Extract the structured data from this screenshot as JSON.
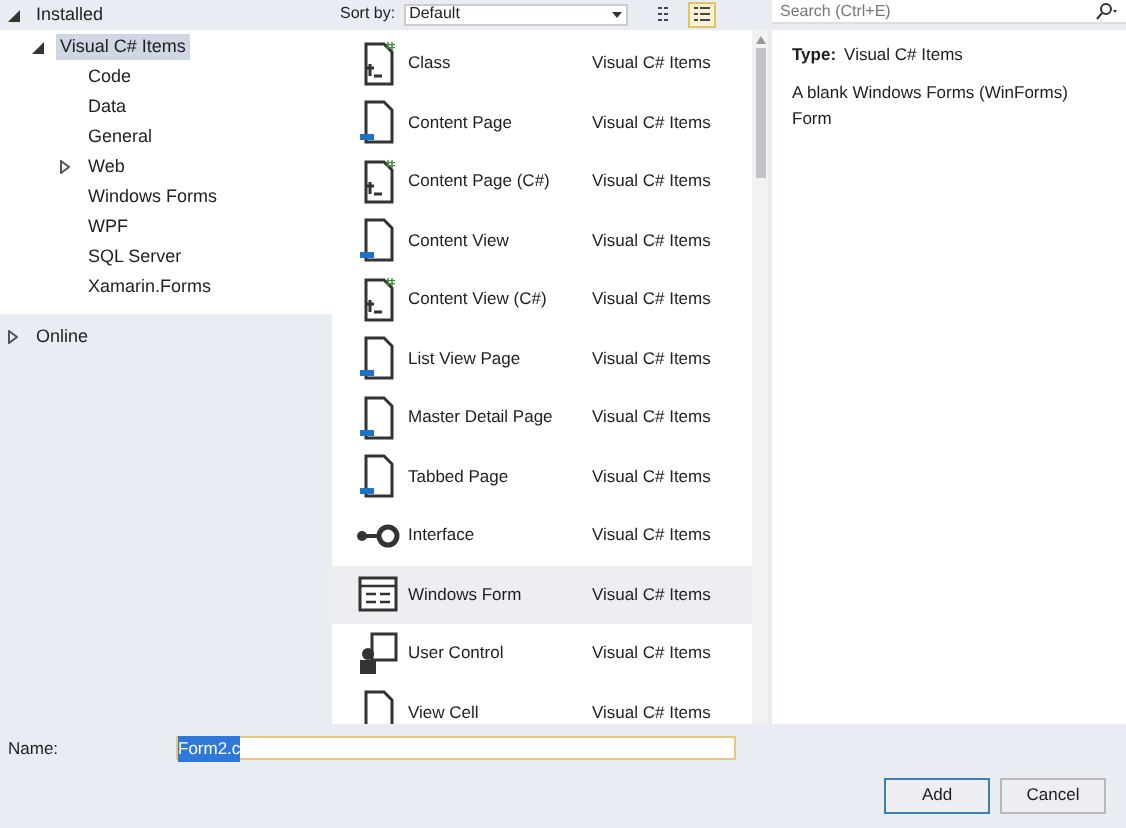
{
  "tree": [
    {
      "label": "Installed",
      "expanded": true,
      "selected": false,
      "children": [
        {
          "label": "Visual C# Items",
          "expanded": true,
          "selected": true,
          "children": [
            {
              "label": "Code",
              "selected": false
            },
            {
              "label": "Data",
              "selected": false
            },
            {
              "label": "General",
              "selected": false
            },
            {
              "label": "Web",
              "expanded": false,
              "selected": false
            },
            {
              "label": "Windows Forms",
              "selected": false
            },
            {
              "label": "WPF",
              "selected": false
            },
            {
              "label": "SQL Server",
              "selected": false
            },
            {
              "label": "Xamarin.Forms",
              "selected": false
            }
          ]
        }
      ]
    },
    {
      "label": "Online",
      "expanded": false,
      "selected": false
    }
  ],
  "sort": {
    "label": "Sort by:",
    "value": "Default"
  },
  "view_modes": [
    {
      "kind": "grid",
      "selected": false
    },
    {
      "kind": "list",
      "selected": true
    }
  ],
  "templates": [
    {
      "name": "Class",
      "category": "Visual C# Items",
      "kind": "code",
      "selected": false
    },
    {
      "name": "Content Page",
      "category": "Visual C# Items",
      "kind": "page",
      "selected": false
    },
    {
      "name": "Content Page (C#)",
      "category": "Visual C# Items",
      "kind": "code",
      "selected": false
    },
    {
      "name": "Content View",
      "category": "Visual C# Items",
      "kind": "page",
      "selected": false
    },
    {
      "name": "Content View (C#)",
      "category": "Visual C# Items",
      "kind": "code",
      "selected": false
    },
    {
      "name": "List View Page",
      "category": "Visual C# Items",
      "kind": "page",
      "selected": false
    },
    {
      "name": "Master Detail Page",
      "category": "Visual C# Items",
      "kind": "page",
      "selected": false
    },
    {
      "name": "Tabbed Page",
      "category": "Visual C# Items",
      "kind": "page",
      "selected": false
    },
    {
      "name": "Interface",
      "category": "Visual C# Items",
      "kind": "interface",
      "selected": false
    },
    {
      "name": "Windows Form",
      "category": "Visual C# Items",
      "kind": "form",
      "selected": true
    },
    {
      "name": "User Control",
      "category": "Visual C# Items",
      "kind": "control",
      "selected": false
    },
    {
      "name": "View Cell",
      "category": "Visual C# Items",
      "kind": "blank",
      "selected": false
    }
  ],
  "search": {
    "placeholder": "Search (Ctrl+E)"
  },
  "details": {
    "type_label": "Type:",
    "type_value": "Visual C# Items",
    "description": "A blank Windows Forms (WinForms) Form"
  },
  "name_field": {
    "label": "Name:",
    "value": "Form2.c"
  },
  "buttons": [
    {
      "label": "Add",
      "default": true
    },
    {
      "label": "Cancel",
      "default": false
    }
  ]
}
